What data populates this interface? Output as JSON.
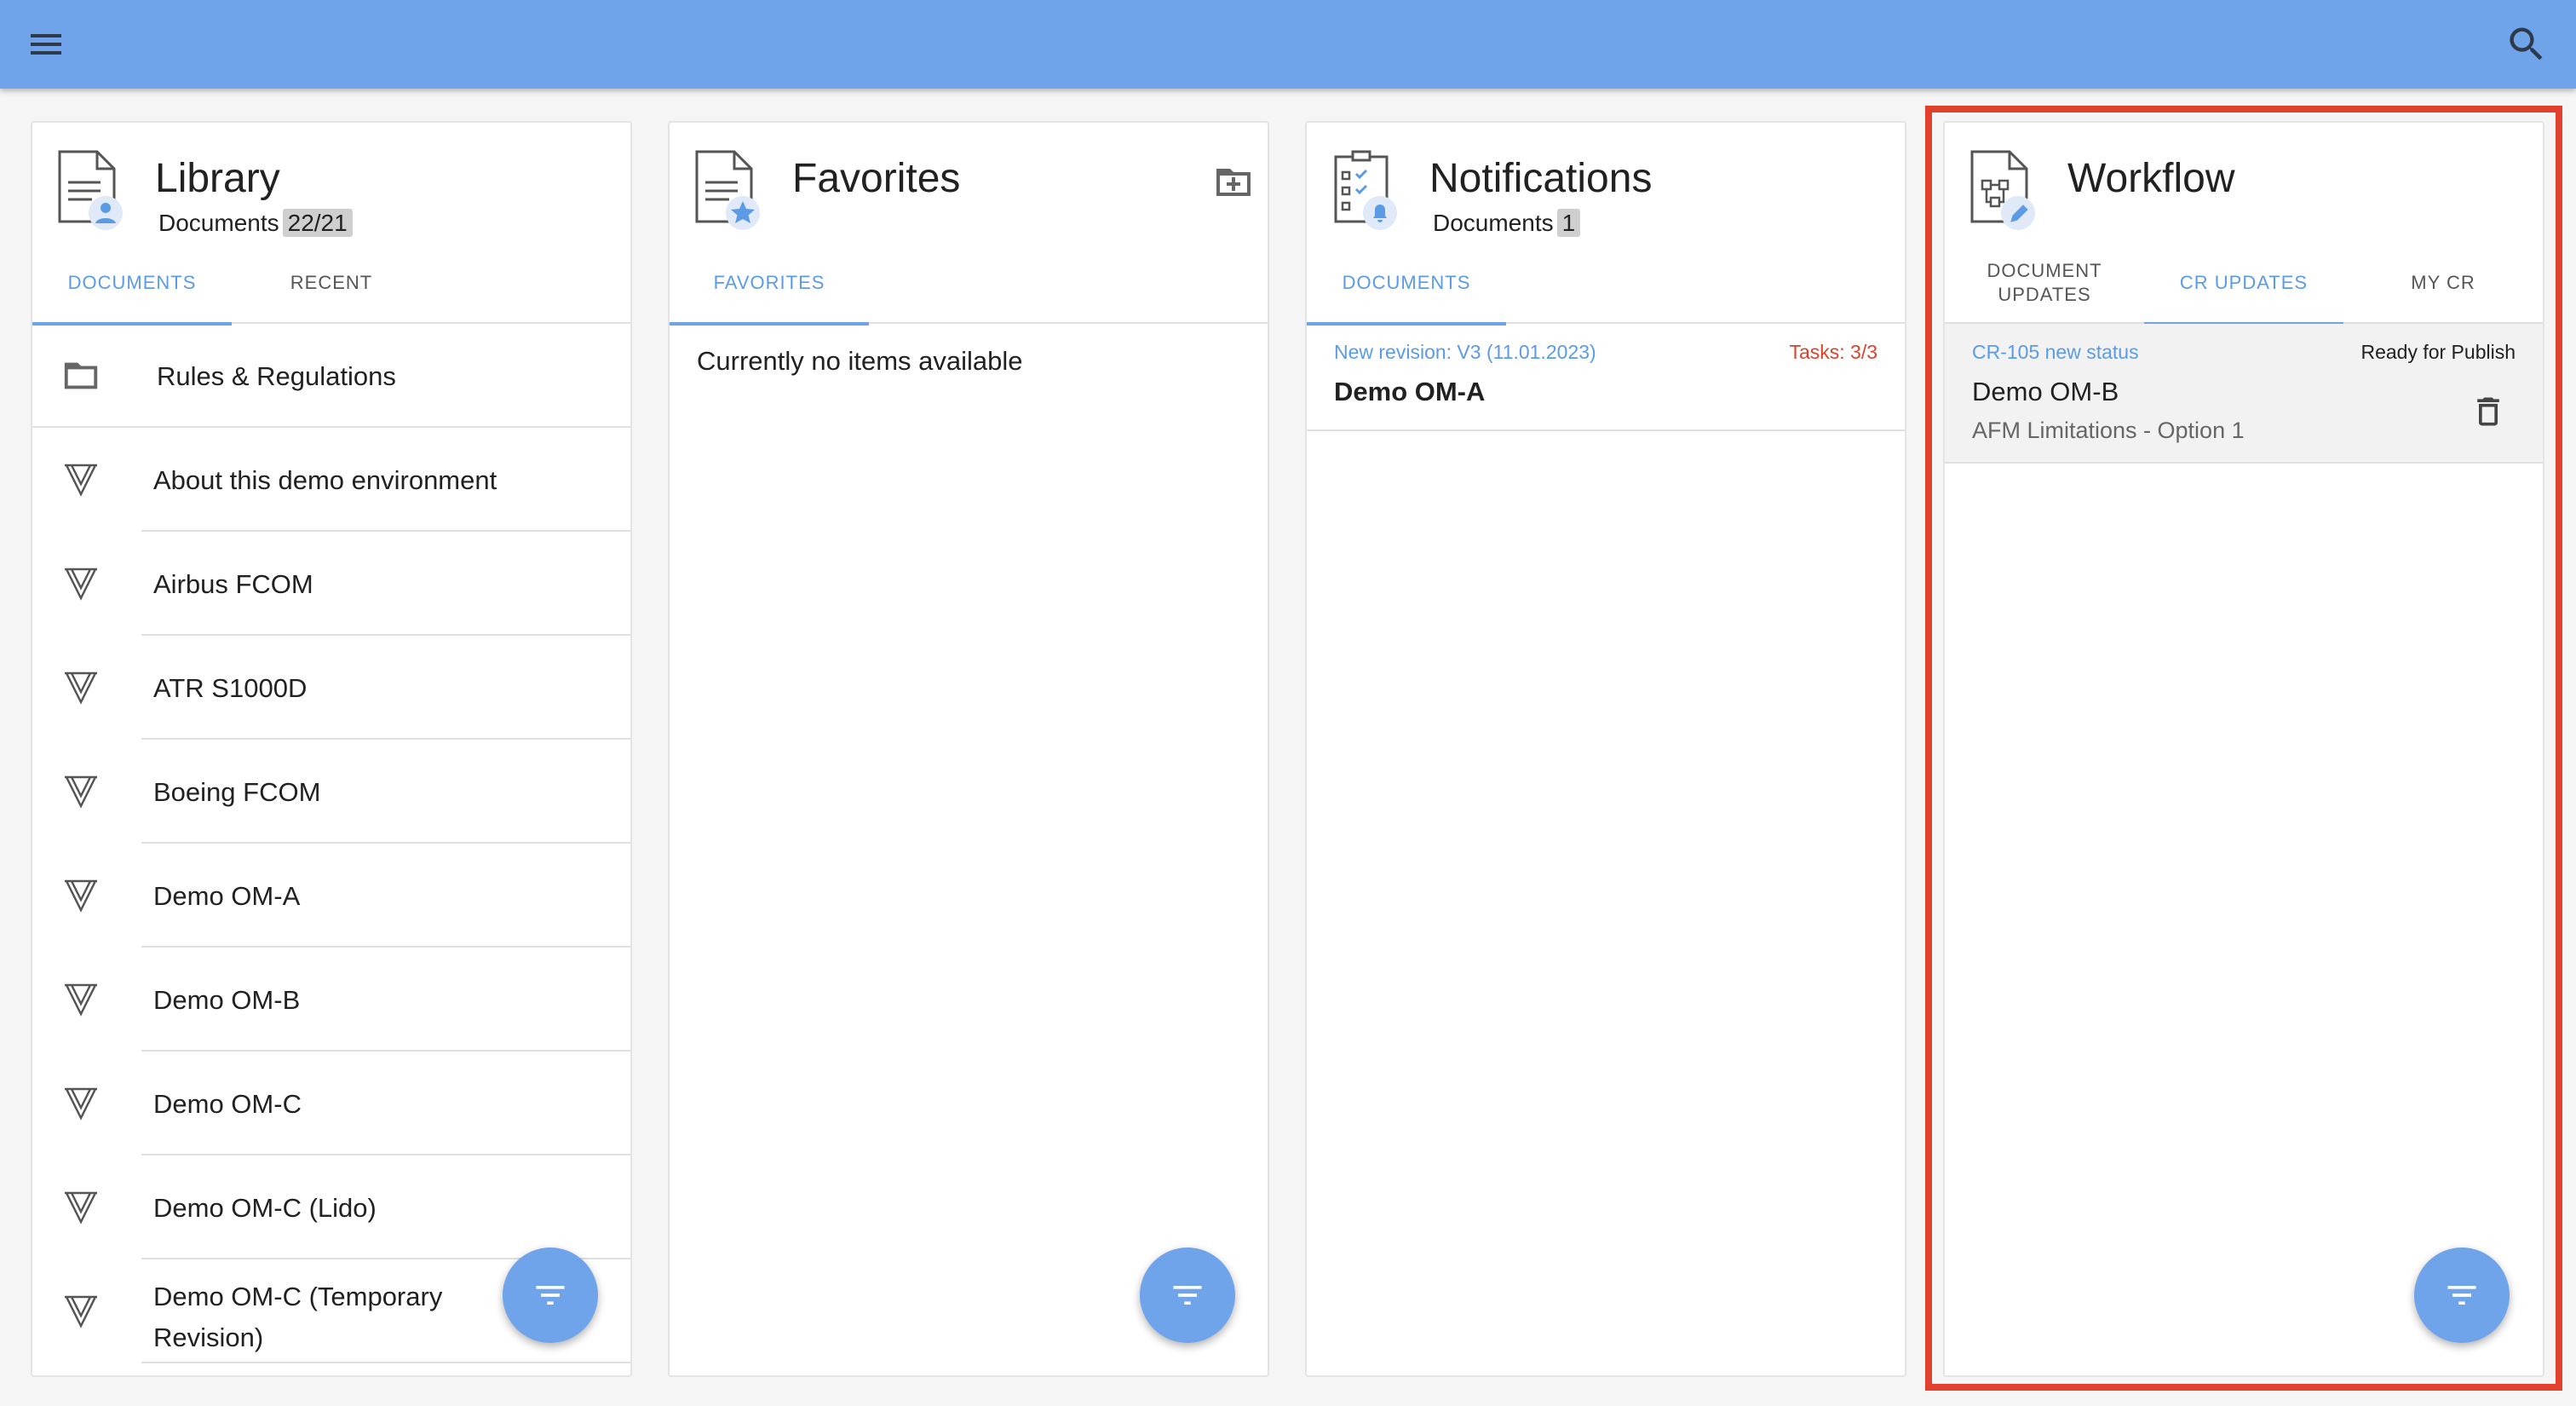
{
  "appbar": {
    "menu_icon": "hamburger-menu-icon",
    "search_icon": "magnifier-search-icon"
  },
  "library": {
    "title": "Library",
    "subtitle": "Documents",
    "count": "22/21",
    "tabs": [
      {
        "label": "DOCUMENTS",
        "active": true
      },
      {
        "label": "RECENT",
        "active": false
      }
    ],
    "items": [
      {
        "label": "Rules & Regulations",
        "type": "folder"
      },
      {
        "label": "About this demo environment",
        "type": "doc"
      },
      {
        "label": "Airbus FCOM",
        "type": "doc"
      },
      {
        "label": "ATR S1000D",
        "type": "doc"
      },
      {
        "label": "Boeing FCOM",
        "type": "doc"
      },
      {
        "label": "Demo OM-A",
        "type": "doc"
      },
      {
        "label": "Demo OM-B",
        "type": "doc"
      },
      {
        "label": "Demo OM-C",
        "type": "doc"
      },
      {
        "label": "Demo OM-C (Lido)",
        "type": "doc"
      },
      {
        "label": "Demo OM-C (Temporary Revision)",
        "type": "doc"
      }
    ]
  },
  "favorites": {
    "title": "Favorites",
    "tabs": [
      {
        "label": "FAVORITES",
        "active": true
      }
    ],
    "empty_text": "Currently no items available"
  },
  "notifications": {
    "title": "Notifications",
    "subtitle": "Documents",
    "count": "1",
    "tabs": [
      {
        "label": "DOCUMENTS",
        "active": true
      }
    ],
    "items": [
      {
        "meta": "New revision: V3 (11.01.2023)",
        "tasks": "Tasks: 3/3",
        "doc": "Demo OM-A"
      }
    ]
  },
  "workflow": {
    "title": "Workflow",
    "tabs": [
      {
        "label": "DOCUMENT UPDATES",
        "active": false
      },
      {
        "label": "CR UPDATES",
        "active": true
      },
      {
        "label": "MY CR",
        "active": false
      }
    ],
    "items": [
      {
        "meta": "CR-105 new status",
        "status": "Ready for Publish",
        "doc": "Demo OM-B",
        "desc": "AFM Limitations - Option 1"
      }
    ]
  },
  "colors": {
    "appbar": "#6fa4eb",
    "accent": "#5b9be6",
    "alert": "#d9432d",
    "highlight": "#e0402c"
  }
}
